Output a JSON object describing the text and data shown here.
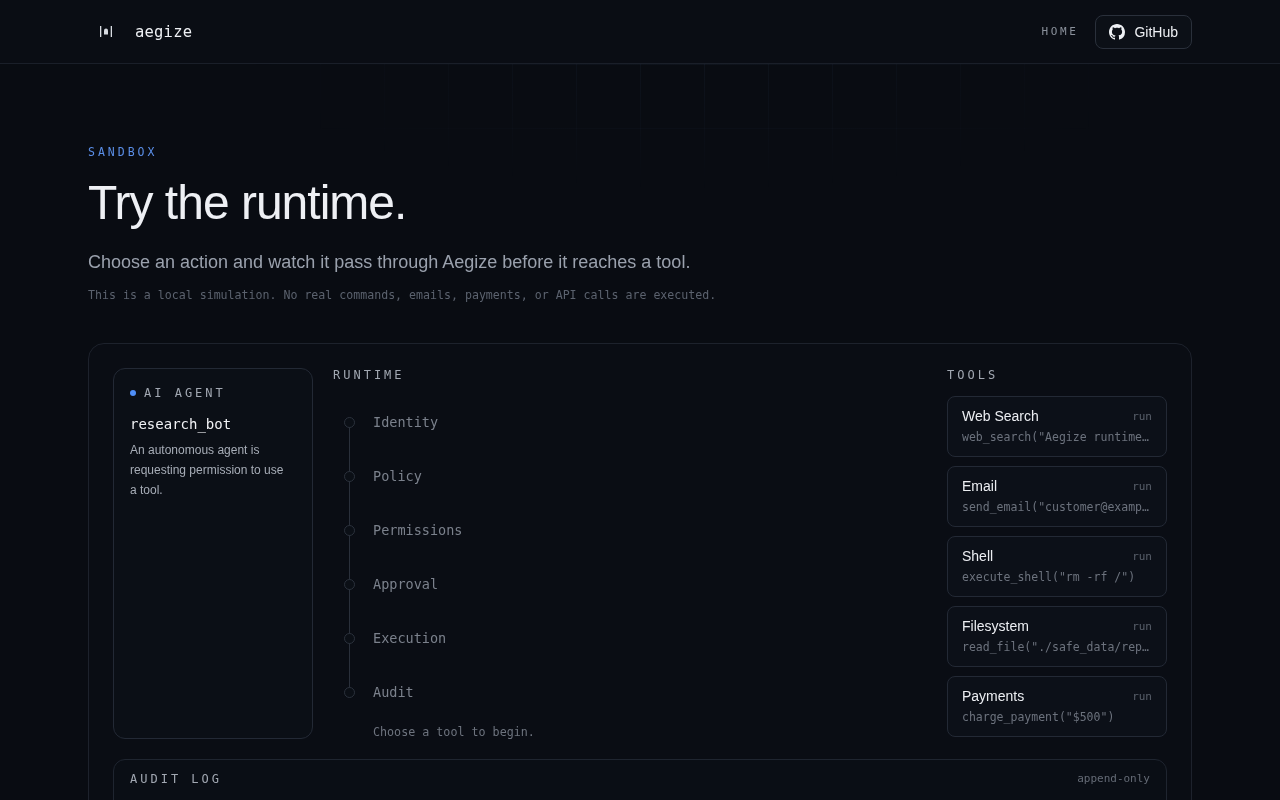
{
  "header": {
    "logo_text": "aegize",
    "nav_link": "HOME",
    "github_button": "GitHub"
  },
  "hero": {
    "eyebrow": "SANDBOX",
    "title": "Try the runtime.",
    "subtitle": "Choose an action and watch it pass through Aegize before it reaches a tool.",
    "note": "This is a local simulation. No real commands, emails, payments, or API calls are executed."
  },
  "sandbox": {
    "agent": {
      "label": "AI AGENT",
      "name": "research_bot",
      "description": "An autonomous agent is requesting permission to use a tool."
    },
    "runtime": {
      "label": "RUNTIME",
      "steps": [
        {
          "label": "Identity"
        },
        {
          "label": "Policy"
        },
        {
          "label": "Permissions"
        },
        {
          "label": "Approval"
        },
        {
          "label": "Execution"
        },
        {
          "label": "Audit"
        }
      ],
      "hint": "Choose a tool to begin."
    },
    "tools": {
      "label": "TOOLS",
      "items": [
        {
          "name": "Web Search",
          "action": "run",
          "call": "web_search(\"Aegize runtime…"
        },
        {
          "name": "Email",
          "action": "run",
          "call": "send_email(\"customer@examp…"
        },
        {
          "name": "Shell",
          "action": "run",
          "call": "execute_shell(\"rm -rf /\")"
        },
        {
          "name": "Filesystem",
          "action": "run",
          "call": "read_file(\"./safe_data/rep…"
        },
        {
          "name": "Payments",
          "action": "run",
          "call": "charge_payment(\"$500\")"
        }
      ]
    },
    "audit_log": {
      "title": "AUDIT LOG",
      "badge": "append-only"
    }
  }
}
